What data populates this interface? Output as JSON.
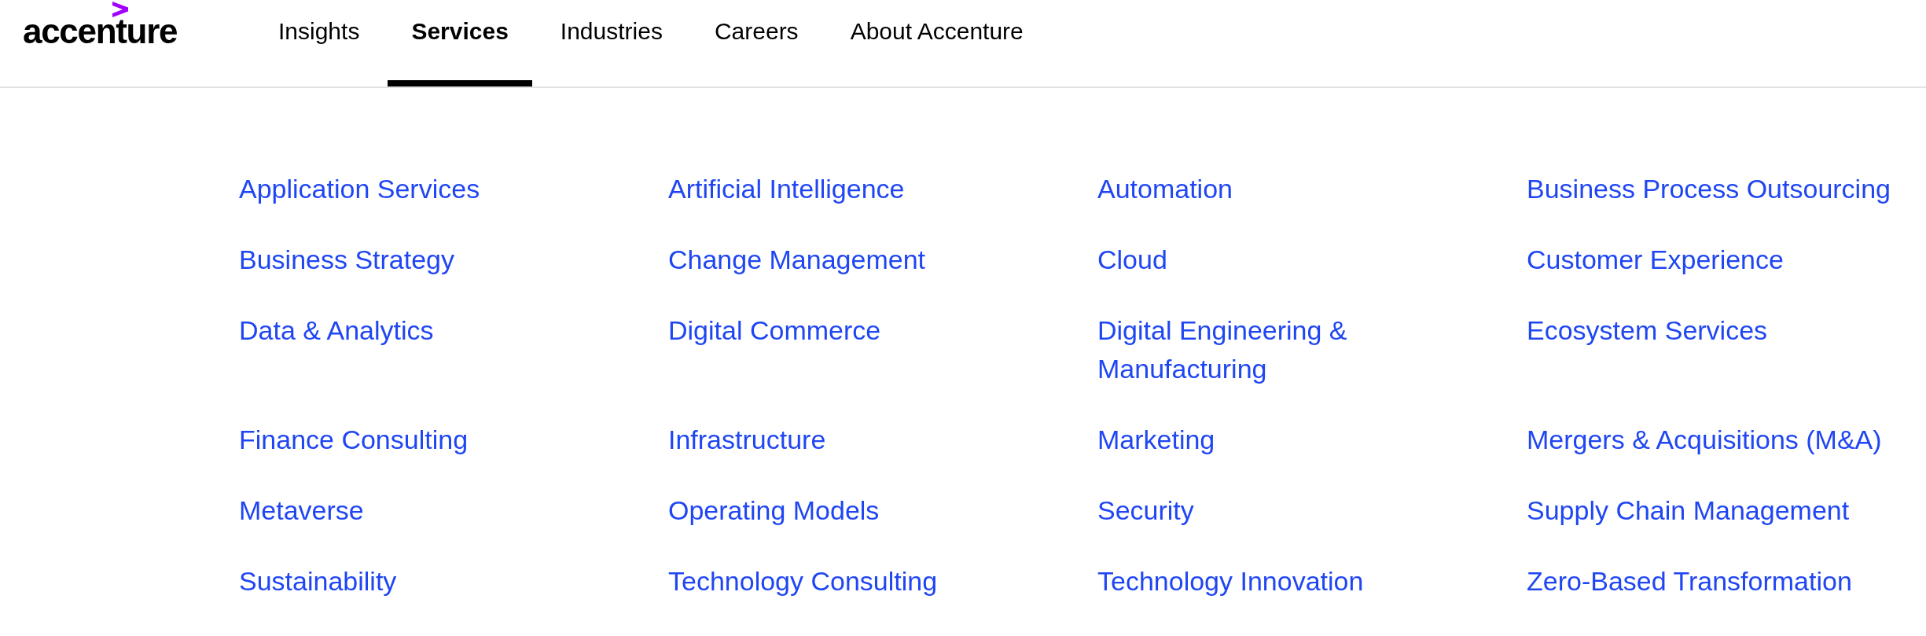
{
  "logo": {
    "text": "accenture"
  },
  "nav": {
    "tabs": [
      {
        "label": "Insights",
        "selected": false
      },
      {
        "label": "Services",
        "selected": true
      },
      {
        "label": "Industries",
        "selected": false
      },
      {
        "label": "Careers",
        "selected": false
      },
      {
        "label": "About Accenture",
        "selected": false
      }
    ]
  },
  "services_menu": {
    "links": [
      "Application Services",
      "Artificial Intelligence",
      "Automation",
      "Business Process Outsourcing",
      "Business Strategy",
      "Change Management",
      "Cloud",
      "Customer Experience",
      "Data & Analytics",
      "Digital Commerce",
      "Digital Engineering & Manufacturing",
      "Ecosystem Services",
      "Finance Consulting",
      "Infrastructure",
      "Marketing",
      "Mergers & Acquisitions (M&A)",
      "Metaverse",
      "Operating Models",
      "Security",
      "Supply Chain Management",
      "Sustainability",
      "Technology Consulting",
      "Technology Innovation",
      "Zero-Based Transformation"
    ]
  }
}
